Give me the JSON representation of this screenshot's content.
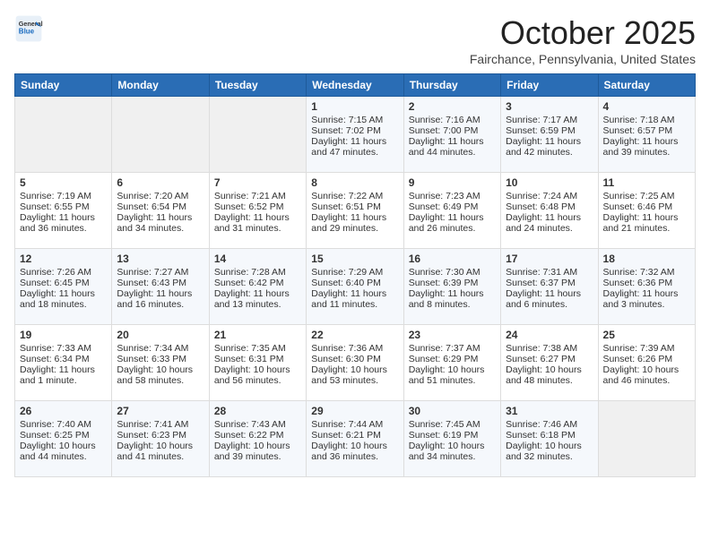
{
  "header": {
    "logo": {
      "general": "General",
      "blue": "Blue"
    },
    "title": "October 2025",
    "location": "Fairchance, Pennsylvania, United States"
  },
  "days_of_week": [
    "Sunday",
    "Monday",
    "Tuesday",
    "Wednesday",
    "Thursday",
    "Friday",
    "Saturday"
  ],
  "weeks": [
    [
      {
        "day": "",
        "info": ""
      },
      {
        "day": "",
        "info": ""
      },
      {
        "day": "",
        "info": ""
      },
      {
        "day": "1",
        "info": "Sunrise: 7:15 AM\nSunset: 7:02 PM\nDaylight: 11 hours\nand 47 minutes."
      },
      {
        "day": "2",
        "info": "Sunrise: 7:16 AM\nSunset: 7:00 PM\nDaylight: 11 hours\nand 44 minutes."
      },
      {
        "day": "3",
        "info": "Sunrise: 7:17 AM\nSunset: 6:59 PM\nDaylight: 11 hours\nand 42 minutes."
      },
      {
        "day": "4",
        "info": "Sunrise: 7:18 AM\nSunset: 6:57 PM\nDaylight: 11 hours\nand 39 minutes."
      }
    ],
    [
      {
        "day": "5",
        "info": "Sunrise: 7:19 AM\nSunset: 6:55 PM\nDaylight: 11 hours\nand 36 minutes."
      },
      {
        "day": "6",
        "info": "Sunrise: 7:20 AM\nSunset: 6:54 PM\nDaylight: 11 hours\nand 34 minutes."
      },
      {
        "day": "7",
        "info": "Sunrise: 7:21 AM\nSunset: 6:52 PM\nDaylight: 11 hours\nand 31 minutes."
      },
      {
        "day": "8",
        "info": "Sunrise: 7:22 AM\nSunset: 6:51 PM\nDaylight: 11 hours\nand 29 minutes."
      },
      {
        "day": "9",
        "info": "Sunrise: 7:23 AM\nSunset: 6:49 PM\nDaylight: 11 hours\nand 26 minutes."
      },
      {
        "day": "10",
        "info": "Sunrise: 7:24 AM\nSunset: 6:48 PM\nDaylight: 11 hours\nand 24 minutes."
      },
      {
        "day": "11",
        "info": "Sunrise: 7:25 AM\nSunset: 6:46 PM\nDaylight: 11 hours\nand 21 minutes."
      }
    ],
    [
      {
        "day": "12",
        "info": "Sunrise: 7:26 AM\nSunset: 6:45 PM\nDaylight: 11 hours\nand 18 minutes."
      },
      {
        "day": "13",
        "info": "Sunrise: 7:27 AM\nSunset: 6:43 PM\nDaylight: 11 hours\nand 16 minutes."
      },
      {
        "day": "14",
        "info": "Sunrise: 7:28 AM\nSunset: 6:42 PM\nDaylight: 11 hours\nand 13 minutes."
      },
      {
        "day": "15",
        "info": "Sunrise: 7:29 AM\nSunset: 6:40 PM\nDaylight: 11 hours\nand 11 minutes."
      },
      {
        "day": "16",
        "info": "Sunrise: 7:30 AM\nSunset: 6:39 PM\nDaylight: 11 hours\nand 8 minutes."
      },
      {
        "day": "17",
        "info": "Sunrise: 7:31 AM\nSunset: 6:37 PM\nDaylight: 11 hours\nand 6 minutes."
      },
      {
        "day": "18",
        "info": "Sunrise: 7:32 AM\nSunset: 6:36 PM\nDaylight: 11 hours\nand 3 minutes."
      }
    ],
    [
      {
        "day": "19",
        "info": "Sunrise: 7:33 AM\nSunset: 6:34 PM\nDaylight: 11 hours\nand 1 minute."
      },
      {
        "day": "20",
        "info": "Sunrise: 7:34 AM\nSunset: 6:33 PM\nDaylight: 10 hours\nand 58 minutes."
      },
      {
        "day": "21",
        "info": "Sunrise: 7:35 AM\nSunset: 6:31 PM\nDaylight: 10 hours\nand 56 minutes."
      },
      {
        "day": "22",
        "info": "Sunrise: 7:36 AM\nSunset: 6:30 PM\nDaylight: 10 hours\nand 53 minutes."
      },
      {
        "day": "23",
        "info": "Sunrise: 7:37 AM\nSunset: 6:29 PM\nDaylight: 10 hours\nand 51 minutes."
      },
      {
        "day": "24",
        "info": "Sunrise: 7:38 AM\nSunset: 6:27 PM\nDaylight: 10 hours\nand 48 minutes."
      },
      {
        "day": "25",
        "info": "Sunrise: 7:39 AM\nSunset: 6:26 PM\nDaylight: 10 hours\nand 46 minutes."
      }
    ],
    [
      {
        "day": "26",
        "info": "Sunrise: 7:40 AM\nSunset: 6:25 PM\nDaylight: 10 hours\nand 44 minutes."
      },
      {
        "day": "27",
        "info": "Sunrise: 7:41 AM\nSunset: 6:23 PM\nDaylight: 10 hours\nand 41 minutes."
      },
      {
        "day": "28",
        "info": "Sunrise: 7:43 AM\nSunset: 6:22 PM\nDaylight: 10 hours\nand 39 minutes."
      },
      {
        "day": "29",
        "info": "Sunrise: 7:44 AM\nSunset: 6:21 PM\nDaylight: 10 hours\nand 36 minutes."
      },
      {
        "day": "30",
        "info": "Sunrise: 7:45 AM\nSunset: 6:19 PM\nDaylight: 10 hours\nand 34 minutes."
      },
      {
        "day": "31",
        "info": "Sunrise: 7:46 AM\nSunset: 6:18 PM\nDaylight: 10 hours\nand 32 minutes."
      },
      {
        "day": "",
        "info": ""
      }
    ]
  ]
}
